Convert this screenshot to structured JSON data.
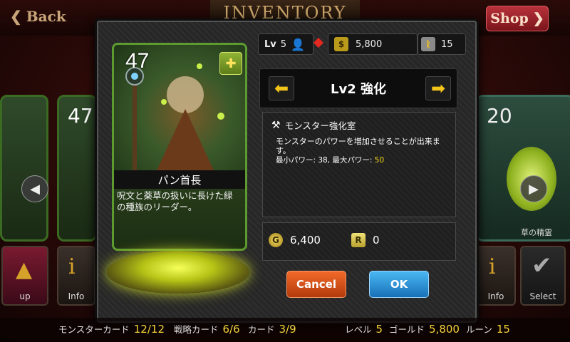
{
  "topbar": {
    "back_label": "Back",
    "title": "INVENTORY",
    "shop_label": "Shop"
  },
  "side_cards": {
    "left_level": "47",
    "right_level": "20",
    "right_name": "草の精霊"
  },
  "slots": {
    "left_up": "up",
    "left_info": "Info",
    "right_info": "Info",
    "right_select": "Select"
  },
  "modal": {
    "player_level_label": "Lv",
    "player_level": "5",
    "gold": "5,800",
    "rune": "15",
    "card": {
      "level": "47",
      "name": "パン首長",
      "description": "呪文と薬草の扱いに長けた緑の種族のリーダー。"
    },
    "upgrade": {
      "title": "Lv2 強化",
      "room_name": "モンスター強化室",
      "description": "モンスターのパワーを増加させることが出来ます。",
      "min_power_label": "最小パワー: 38, 最大パワー:",
      "max_power": "50"
    },
    "cost": {
      "gold_icon": "G",
      "gold": "6,400",
      "rune_icon": "R",
      "rune": "0"
    },
    "buttons": {
      "cancel": "Cancel",
      "ok": "OK"
    }
  },
  "bottombar": {
    "monster_cards_label": "モンスターカード",
    "monster_cards": "12/12",
    "strategy_cards_label": "戦略カード",
    "strategy_cards": "6/6",
    "cards_label": "カード",
    "cards": "3/9",
    "level_label": "レベル",
    "level": "5",
    "gold_label": "ゴールド",
    "gold": "5,800",
    "rune_label": "ルーン",
    "rune": "15"
  },
  "colors": {
    "accent_gold": "#f3c41a",
    "cancel": "#e0521c",
    "ok": "#2f95dc",
    "card_border": "#5d9a2f"
  }
}
